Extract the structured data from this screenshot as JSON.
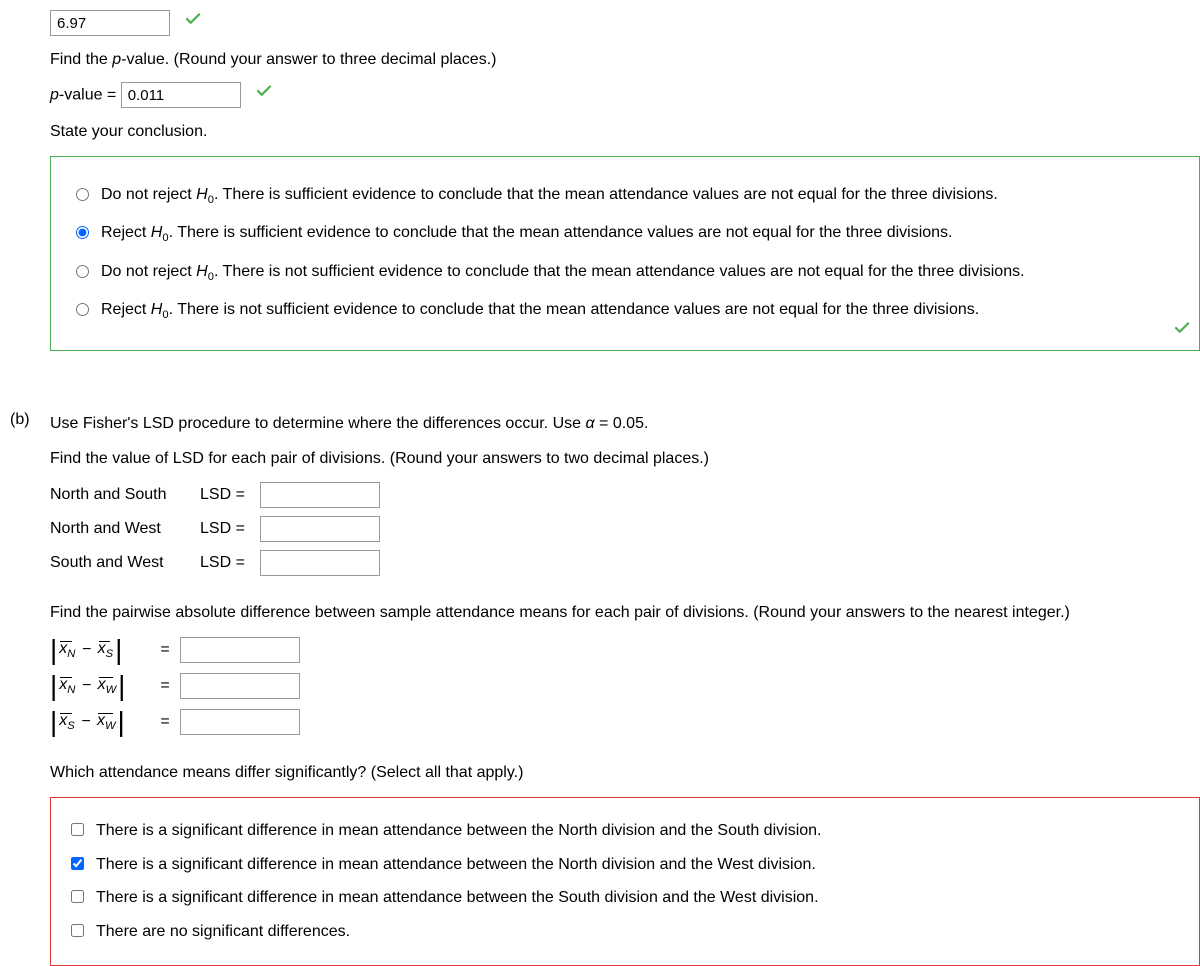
{
  "topInput": {
    "value": "6.97"
  },
  "pvalue": {
    "prompt": "Find the ",
    "promptItalic": "p",
    "promptAfter": "-value. (Round your answer to three decimal places.)",
    "labelItalic": "p",
    "labelAfter": "-value = ",
    "value": "0.011"
  },
  "conclusion": {
    "title": "State your conclusion.",
    "options": [
      {
        "prefix": "Do not reject ",
        "hsym": "H",
        "hsub": "0",
        "suffix": ". There is sufficient evidence to conclude that the mean attendance values are not equal for the three divisions.",
        "selected": false
      },
      {
        "prefix": "Reject ",
        "hsym": "H",
        "hsub": "0",
        "suffix": ". There is sufficient evidence to conclude that the mean attendance values are not equal for the three divisions.",
        "selected": true
      },
      {
        "prefix": "Do not reject ",
        "hsym": "H",
        "hsub": "0",
        "suffix": ". There is not sufficient evidence to conclude that the mean attendance values are not equal for the three divisions.",
        "selected": false
      },
      {
        "prefix": "Reject ",
        "hsym": "H",
        "hsub": "0",
        "suffix": ". There is not sufficient evidence to conclude that the mean attendance values are not equal for the three divisions.",
        "selected": false
      }
    ]
  },
  "partB": {
    "label": "(b)",
    "intro": "Use Fisher's LSD procedure to determine where the differences occur. Use ",
    "alpha": "α",
    "alphaEq": " = 0.05.",
    "lsdPrompt": "Find the value of LSD for each pair of divisions. (Round your answers to two decimal places.)",
    "lsdRows": [
      {
        "label": "North and South",
        "eq": "LSD ="
      },
      {
        "label": "North and West",
        "eq": "LSD ="
      },
      {
        "label": "South and West",
        "eq": "LSD ="
      }
    ],
    "pairwisePrompt": "Find the pairwise absolute difference between sample attendance means for each pair of divisions. (Round your answers to the nearest integer.)",
    "absRows": [
      {
        "sub1": "N",
        "sub2": "S"
      },
      {
        "sub1": "N",
        "sub2": "W"
      },
      {
        "sub1": "S",
        "sub2": "W"
      }
    ],
    "whichPrompt": "Which attendance means differ significantly? (Select all that apply.)",
    "checkboxes": [
      {
        "text": "There is a significant difference in mean attendance between the North division and the South division.",
        "checked": false
      },
      {
        "text": "There is a significant difference in mean attendance between the North division and the West division.",
        "checked": true
      },
      {
        "text": "There is a significant difference in mean attendance between the South division and the West division.",
        "checked": false
      },
      {
        "text": "There are no significant differences.",
        "checked": false
      }
    ]
  }
}
